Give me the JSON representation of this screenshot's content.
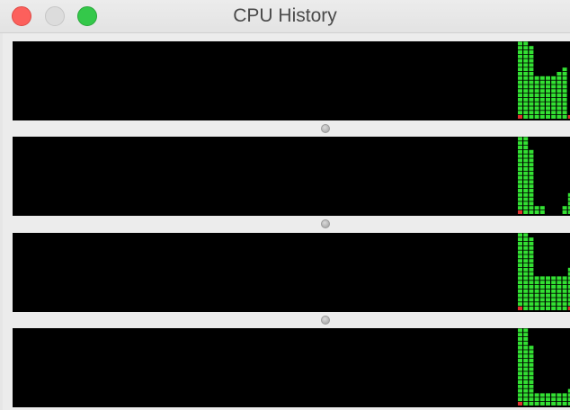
{
  "window": {
    "title": "CPU History"
  },
  "colors": {
    "graph_background": "#000000",
    "bar_green": "#33e033",
    "bar_red": "#e03030",
    "window_background": "#ececec"
  },
  "cpu_cores": [
    {
      "history_bars": [
        {
          "level": 0.92,
          "red_base": true
        },
        {
          "level": 0.92
        },
        {
          "level": 0.8
        },
        {
          "level": 0.48
        },
        {
          "level": 0.48
        },
        {
          "level": 0.48
        },
        {
          "level": 0.48
        },
        {
          "level": 0.52
        },
        {
          "level": 0.56
        },
        {
          "level": 0.0,
          "red_base": true
        }
      ]
    },
    {
      "history_bars": [
        {
          "level": 1.0,
          "red_base": true
        },
        {
          "level": 0.92
        },
        {
          "level": 0.7
        },
        {
          "level": 0.08
        },
        {
          "level": 0.08
        },
        {
          "level": 0.0
        },
        {
          "level": 0.0
        },
        {
          "level": 0.0
        },
        {
          "level": 0.08
        },
        {
          "level": 0.24
        }
      ]
    },
    {
      "history_bars": [
        {
          "level": 0.96,
          "red_base": true
        },
        {
          "level": 0.92
        },
        {
          "level": 0.8
        },
        {
          "level": 0.4
        },
        {
          "level": 0.4
        },
        {
          "level": 0.4
        },
        {
          "level": 0.4
        },
        {
          "level": 0.4
        },
        {
          "level": 0.4
        },
        {
          "level": 0.48,
          "red_base": true
        }
      ]
    },
    {
      "history_bars": [
        {
          "level": 0.96,
          "red_base": true
        },
        {
          "level": 0.92
        },
        {
          "level": 0.68
        },
        {
          "level": 0.16
        },
        {
          "level": 0.16
        },
        {
          "level": 0.12
        },
        {
          "level": 0.16
        },
        {
          "level": 0.16
        },
        {
          "level": 0.16
        },
        {
          "level": 0.2
        }
      ]
    }
  ]
}
